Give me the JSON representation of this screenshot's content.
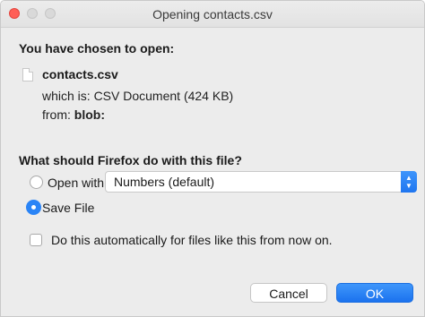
{
  "window": {
    "title": "Opening contacts.csv"
  },
  "file": {
    "heading": "You have chosen to open:",
    "name": "contacts.csv",
    "which_is": "which is: CSV Document (424 KB)",
    "from_label": "from:",
    "from_value": "blob:"
  },
  "action": {
    "heading": "What should Firefox do with this file?",
    "open_with_label": "Open with",
    "open_with_app": "Numbers (default)",
    "save_file_label": "Save File",
    "selected": "Save File"
  },
  "auto": {
    "label": "Do this automatically for files like this from now on.",
    "checked": false
  },
  "buttons": {
    "cancel": "Cancel",
    "ok": "OK"
  },
  "colors": {
    "accent": "#2a84f6",
    "close": "#ff5f57"
  }
}
